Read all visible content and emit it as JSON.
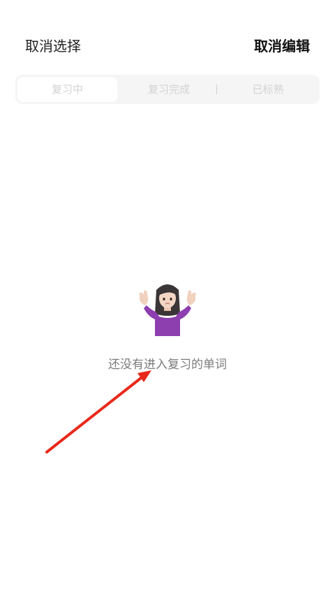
{
  "header": {
    "cancel_selection_label": "取消选择",
    "cancel_edit_label": "取消编辑"
  },
  "tabs": [
    {
      "label": "复习中",
      "active": true
    },
    {
      "label": "复习完成",
      "active": false
    },
    {
      "label": "已标熟",
      "active": false
    }
  ],
  "empty_state": {
    "icon": "person-shrugging-emoji",
    "message": "还没有进入复习的单词"
  },
  "annotation": {
    "icon": "red-arrow-icon",
    "color": "#e8291c"
  }
}
